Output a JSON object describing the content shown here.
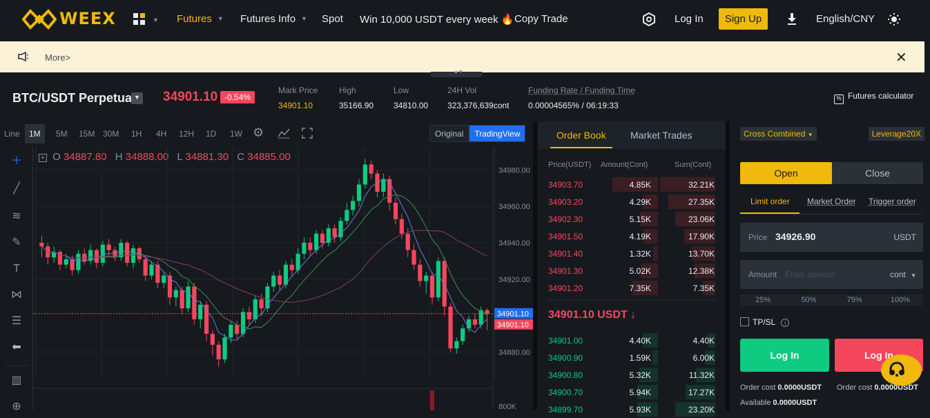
{
  "nav": {
    "brand": "WEEX",
    "items": [
      "Futures",
      "Futures Info",
      "Spot",
      "Win 10,000 USDT every week",
      "Copy Trade"
    ],
    "login": "Log In",
    "signup": "Sign Up",
    "language": "English/CNY"
  },
  "banner": {
    "more": "More>"
  },
  "ticker": {
    "pair": "BTC/USDT Perpetual",
    "last_price": "34901.10",
    "change": "-0.54%",
    "stats": [
      {
        "label": "Mark Price",
        "value": "34901.10"
      },
      {
        "label": "High",
        "value": "35166.90"
      },
      {
        "label": "Low",
        "value": "34810.00"
      },
      {
        "label": "24H Vol",
        "value": "323,376,639cont"
      },
      {
        "label": "Funding Rate / Funding Time",
        "value": "0.00004565% / 06:19:33"
      }
    ],
    "calculator": "Futures calculator"
  },
  "chart": {
    "timeframes": [
      "Line",
      "1M",
      "5M",
      "15M",
      "30M",
      "1H",
      "4H",
      "12H",
      "1D",
      "1W"
    ],
    "active_timeframe": "1M",
    "view_original": "Original",
    "view_tradingview": "TradingView",
    "ohlc": {
      "o_label": "O",
      "o": "34887.80",
      "h_label": "H",
      "h": "34888.00",
      "l_label": "L",
      "l": "34881.30",
      "c_label": "C",
      "c": "34885.00"
    },
    "price_ticks": [
      "34980.00",
      "34960.00",
      "34940.00",
      "34920.00",
      "34880.00",
      "800K"
    ],
    "mark_label": "34901.10",
    "last_label": "34901.10"
  },
  "chart_data": {
    "type": "candlestick",
    "ylim": [
      34865,
      34990
    ],
    "last_price": 34901.1,
    "candles": [
      [
        34940,
        34938,
        34944,
        34932
      ],
      [
        34938,
        34932,
        34940,
        34928
      ],
      [
        34932,
        34935,
        34938,
        34929
      ],
      [
        34935,
        34928,
        34936,
        34925
      ],
      [
        34928,
        34931,
        34934,
        34926
      ],
      [
        34931,
        34925,
        34933,
        34922
      ],
      [
        34925,
        34934,
        34936,
        34923
      ],
      [
        34934,
        34930,
        34937,
        34928
      ],
      [
        34930,
        34936,
        34939,
        34928
      ],
      [
        34936,
        34929,
        34937,
        34926
      ],
      [
        34929,
        34939,
        34941,
        34927
      ],
      [
        34939,
        34936,
        34942,
        34933
      ],
      [
        34936,
        34932,
        34938,
        34930
      ],
      [
        34932,
        34940,
        34942,
        34930
      ],
      [
        34940,
        34929,
        34941,
        34927
      ],
      [
        34929,
        34937,
        34939,
        34926
      ],
      [
        34937,
        34931,
        34938,
        34929
      ],
      [
        34931,
        34922,
        34933,
        34919
      ],
      [
        34922,
        34928,
        34930,
        34920
      ],
      [
        34928,
        34918,
        34930,
        34915
      ],
      [
        34918,
        34922,
        34924,
        34915
      ],
      [
        34922,
        34910,
        34924,
        34906
      ],
      [
        34910,
        34914,
        34916,
        34905
      ],
      [
        34914,
        34904,
        34916,
        34901
      ],
      [
        34904,
        34916,
        34919,
        34902
      ],
      [
        34916,
        34898,
        34918,
        34895
      ],
      [
        34898,
        34906,
        34908,
        34893
      ],
      [
        34906,
        34890,
        34908,
        34886
      ],
      [
        34890,
        34884,
        34892,
        34878
      ],
      [
        34884,
        34876,
        34886,
        34872
      ],
      [
        34876,
        34888,
        34890,
        34874
      ],
      [
        34888,
        34895,
        34897,
        34885
      ],
      [
        34895,
        34890,
        34897,
        34887
      ],
      [
        34890,
        34902,
        34904,
        34888
      ],
      [
        34902,
        34898,
        34905,
        34895
      ],
      [
        34898,
        34909,
        34911,
        34896
      ],
      [
        34909,
        34904,
        34912,
        34900
      ],
      [
        34904,
        34916,
        34918,
        34902
      ],
      [
        34916,
        34922,
        34924,
        34913
      ],
      [
        34922,
        34917,
        34925,
        34914
      ],
      [
        34917,
        34928,
        34930,
        34915
      ],
      [
        34928,
        34925,
        34931,
        34922
      ],
      [
        34925,
        34934,
        34937,
        34923
      ],
      [
        34934,
        34940,
        34943,
        34931
      ],
      [
        34940,
        34936,
        34943,
        34933
      ],
      [
        34936,
        34945,
        34947,
        34934
      ],
      [
        34945,
        34940,
        34947,
        34937
      ],
      [
        34940,
        34948,
        34950,
        34938
      ],
      [
        34948,
        34943,
        34950,
        34940
      ],
      [
        34943,
        34952,
        34954,
        34941
      ],
      [
        34952,
        34958,
        34962,
        34950
      ],
      [
        34958,
        34963,
        34966,
        34955
      ],
      [
        34963,
        34972,
        34975,
        34960
      ],
      [
        34972,
        34983,
        34986,
        34970
      ],
      [
        34983,
        34978,
        34985,
        34975
      ],
      [
        34978,
        34968,
        34980,
        34965
      ],
      [
        34968,
        34975,
        34978,
        34965
      ],
      [
        34975,
        34962,
        34977,
        34958
      ],
      [
        34962,
        34953,
        34965,
        34950
      ],
      [
        34953,
        34945,
        34956,
        34942
      ],
      [
        34945,
        34936,
        34948,
        34932
      ],
      [
        34936,
        34928,
        34939,
        34925
      ],
      [
        34928,
        34919,
        34931,
        34916
      ],
      [
        34919,
        34922,
        34924,
        34912
      ],
      [
        34922,
        34910,
        34924,
        34906
      ],
      [
        34910,
        34930,
        34932,
        34908
      ],
      [
        34930,
        34905,
        34932,
        34900
      ],
      [
        34905,
        34882,
        34907,
        34880
      ],
      [
        34882,
        34886,
        34888,
        34879
      ],
      [
        34886,
        34893,
        34895,
        34884
      ],
      [
        34893,
        34898,
        34900,
        34891
      ],
      [
        34898,
        34895,
        34901,
        34893
      ],
      [
        34895,
        34903,
        34905,
        34893
      ],
      [
        34903,
        34901,
        34904,
        34892
      ]
    ]
  },
  "orderbook": {
    "tabs": [
      "Order Book",
      "Market Trades"
    ],
    "headers": [
      "Price(USDT)",
      "Amount(Cont)",
      "Sum(Cont)"
    ],
    "asks": [
      {
        "price": "34903.70",
        "amount": "4.85K",
        "sum": "32.21K",
        "af": 0.97,
        "sf": 1.0
      },
      {
        "price": "34903.20",
        "amount": "4.29K",
        "sum": "27.35K",
        "af": 0.32,
        "sf": 0.85
      },
      {
        "price": "34902.30",
        "amount": "5.15K",
        "sum": "23.06K",
        "af": 0.38,
        "sf": 0.72
      },
      {
        "price": "34901.50",
        "amount": "4.19K",
        "sum": "17.90K",
        "af": 0.31,
        "sf": 0.56
      },
      {
        "price": "34901.40",
        "amount": "1.32K",
        "sum": "13.70K",
        "af": 0.1,
        "sf": 0.43
      },
      {
        "price": "34901.30",
        "amount": "5.02K",
        "sum": "12.38K",
        "af": 0.37,
        "sf": 0.38
      },
      {
        "price": "34901.20",
        "amount": "7.35K",
        "sum": "7.35K",
        "af": 0.55,
        "sf": 0.23
      }
    ],
    "mid_price": "34901.10 USDT ↓",
    "bids": [
      {
        "price": "34901.00",
        "amount": "4.40K",
        "sum": "4.40K",
        "af": 0.33,
        "sf": 0.14
      },
      {
        "price": "34900.90",
        "amount": "1.59K",
        "sum": "6.00K",
        "af": 0.12,
        "sf": 0.19
      },
      {
        "price": "34900.80",
        "amount": "5.32K",
        "sum": "11.32K",
        "af": 0.4,
        "sf": 0.35
      },
      {
        "price": "34900.70",
        "amount": "5.94K",
        "sum": "17.27K",
        "af": 0.44,
        "sf": 0.54
      },
      {
        "price": "34899.70",
        "amount": "5.93K",
        "sum": "23.20K",
        "af": 0.44,
        "sf": 0.72
      }
    ]
  },
  "trade": {
    "margin_mode": "Cross Combined",
    "leverage": "Leverage20X",
    "open": "Open",
    "close": "Close",
    "order_types": [
      "Limit order",
      "Market Order",
      "Trigger order"
    ],
    "price_label": "Price",
    "price_value": "34926.90",
    "price_unit": "USDT",
    "amount_label": "Amount",
    "amount_placeholder": "Enter amount",
    "amount_unit": "cont",
    "percents": [
      "25%",
      "50%",
      "75%",
      "100%"
    ],
    "tpsl": "TP/SL",
    "long_button": "Log In",
    "short_button": "Log In",
    "order_cost_label": "Order cost",
    "order_cost_long": "0.0000USDT",
    "order_cost_short": "0.0000USDT",
    "available_label": "Available",
    "available_value": "0.0000USDT"
  }
}
